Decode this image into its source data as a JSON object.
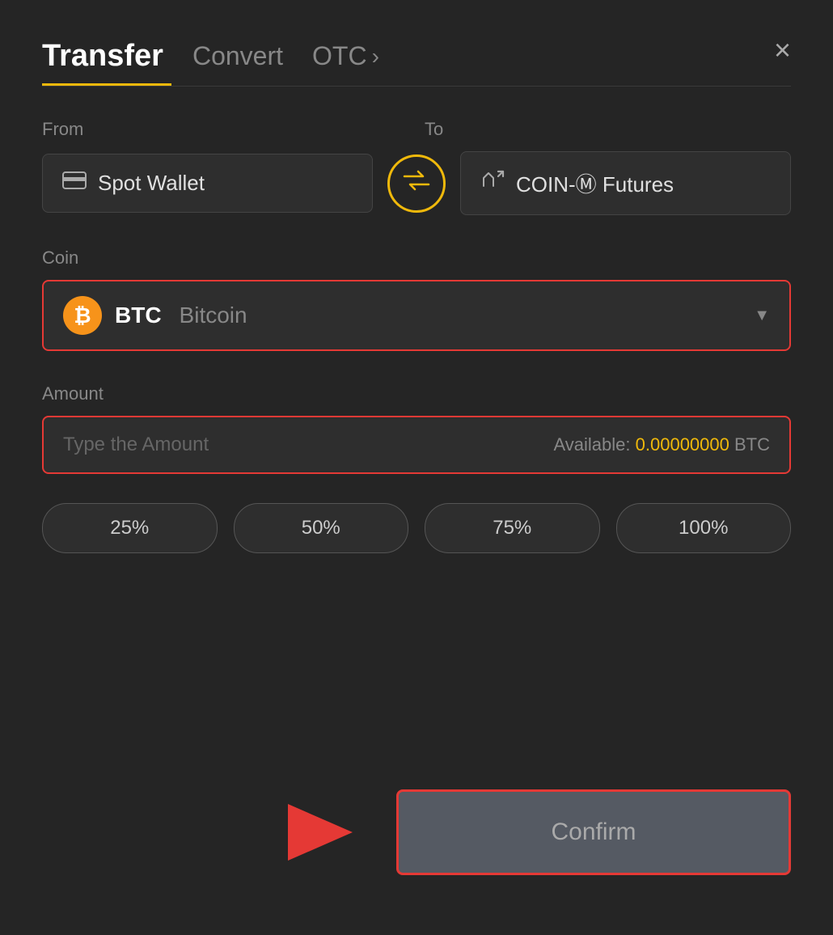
{
  "header": {
    "tab_transfer": "Transfer",
    "tab_convert": "Convert",
    "tab_otc": "OTC",
    "tab_otc_chevron": "›",
    "close_label": "×"
  },
  "from_section": {
    "label": "From",
    "wallet_name": "Spot Wallet"
  },
  "to_section": {
    "label": "To",
    "wallet_name": "COIN-Ⓜ Futures"
  },
  "swap": {
    "icon": "⇄"
  },
  "coin_section": {
    "label": "Coin",
    "coin_symbol": "BTC",
    "coin_name": "Bitcoin",
    "coin_icon": "₿"
  },
  "amount_section": {
    "label": "Amount",
    "placeholder": "Type the Amount",
    "available_label": "Available:",
    "available_amount": "0.00000000",
    "available_currency": "BTC"
  },
  "percentage_buttons": [
    {
      "label": "25%"
    },
    {
      "label": "50%"
    },
    {
      "label": "75%"
    },
    {
      "label": "100%"
    }
  ],
  "confirm": {
    "label": "Confirm"
  }
}
